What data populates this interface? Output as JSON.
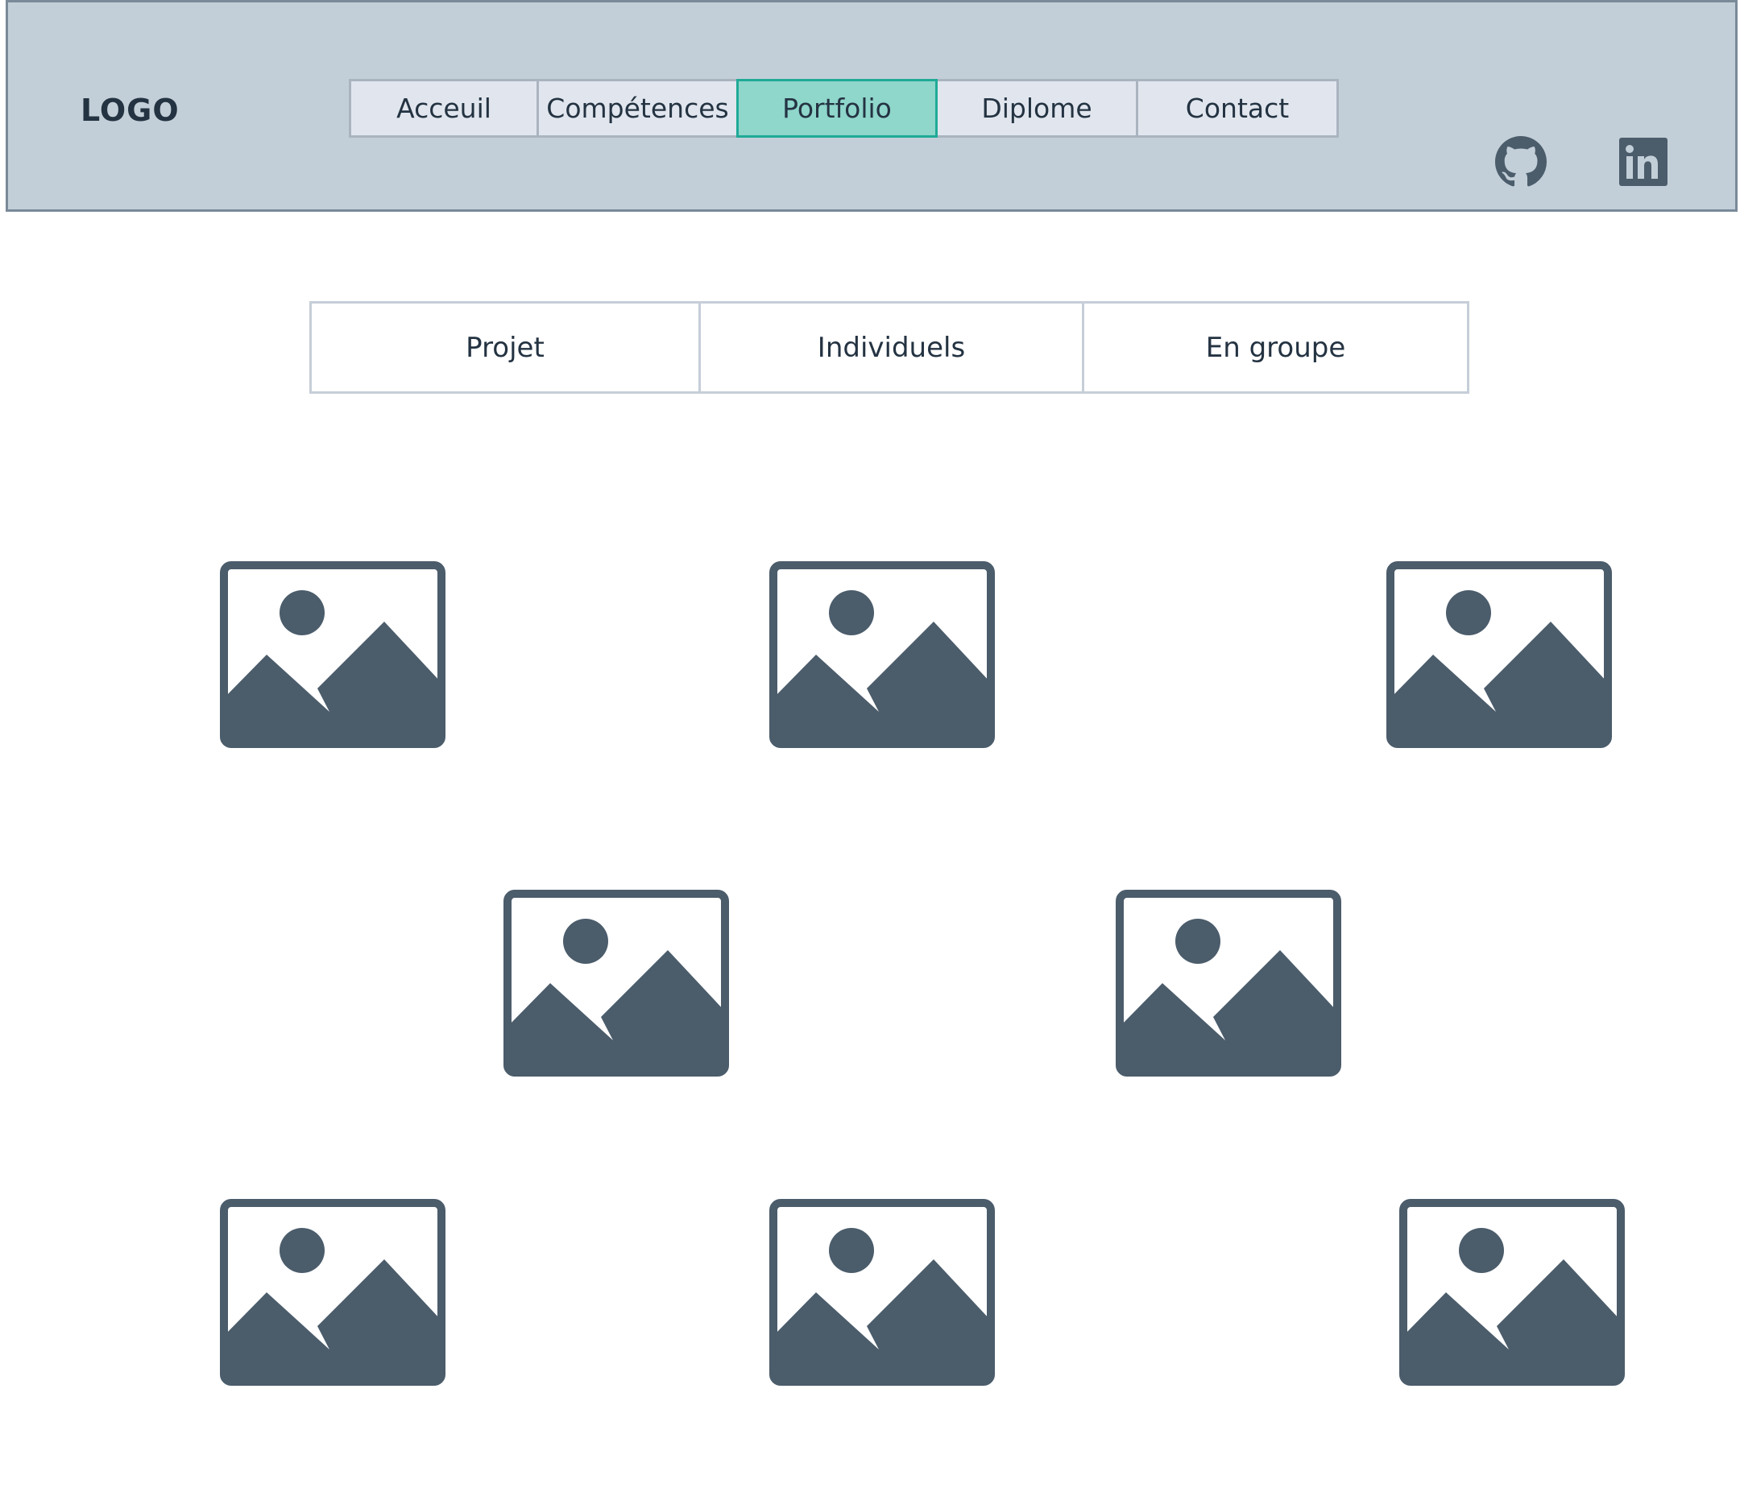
{
  "header": {
    "logo": "LOGO",
    "nav": [
      {
        "label": "Acceuil",
        "active": false
      },
      {
        "label": "Compétences",
        "active": false
      },
      {
        "label": "Portfolio",
        "active": true
      },
      {
        "label": "Diplome",
        "active": false
      },
      {
        "label": "Contact",
        "active": false
      }
    ],
    "social": [
      {
        "icon": "github-icon"
      },
      {
        "icon": "linkedin-icon"
      }
    ]
  },
  "filter_tabs": [
    {
      "label": "Projet"
    },
    {
      "label": "Individuels"
    },
    {
      "label": "En groupe"
    }
  ],
  "gallery": {
    "items": [
      {
        "icon": "image-placeholder-icon"
      },
      {
        "icon": "image-placeholder-icon"
      },
      {
        "icon": "image-placeholder-icon"
      },
      {
        "icon": "image-placeholder-icon"
      },
      {
        "icon": "image-placeholder-icon"
      },
      {
        "icon": "image-placeholder-icon"
      },
      {
        "icon": "image-placeholder-icon"
      },
      {
        "icon": "image-placeholder-icon"
      }
    ]
  },
  "colors": {
    "header_bg": "#c3cfd8",
    "nav_bg": "#e1e6ee",
    "nav_active_bg": "#8fd6cb",
    "nav_active_border": "#1faa97",
    "icon": "#4b5c6b",
    "text": "#243342"
  }
}
